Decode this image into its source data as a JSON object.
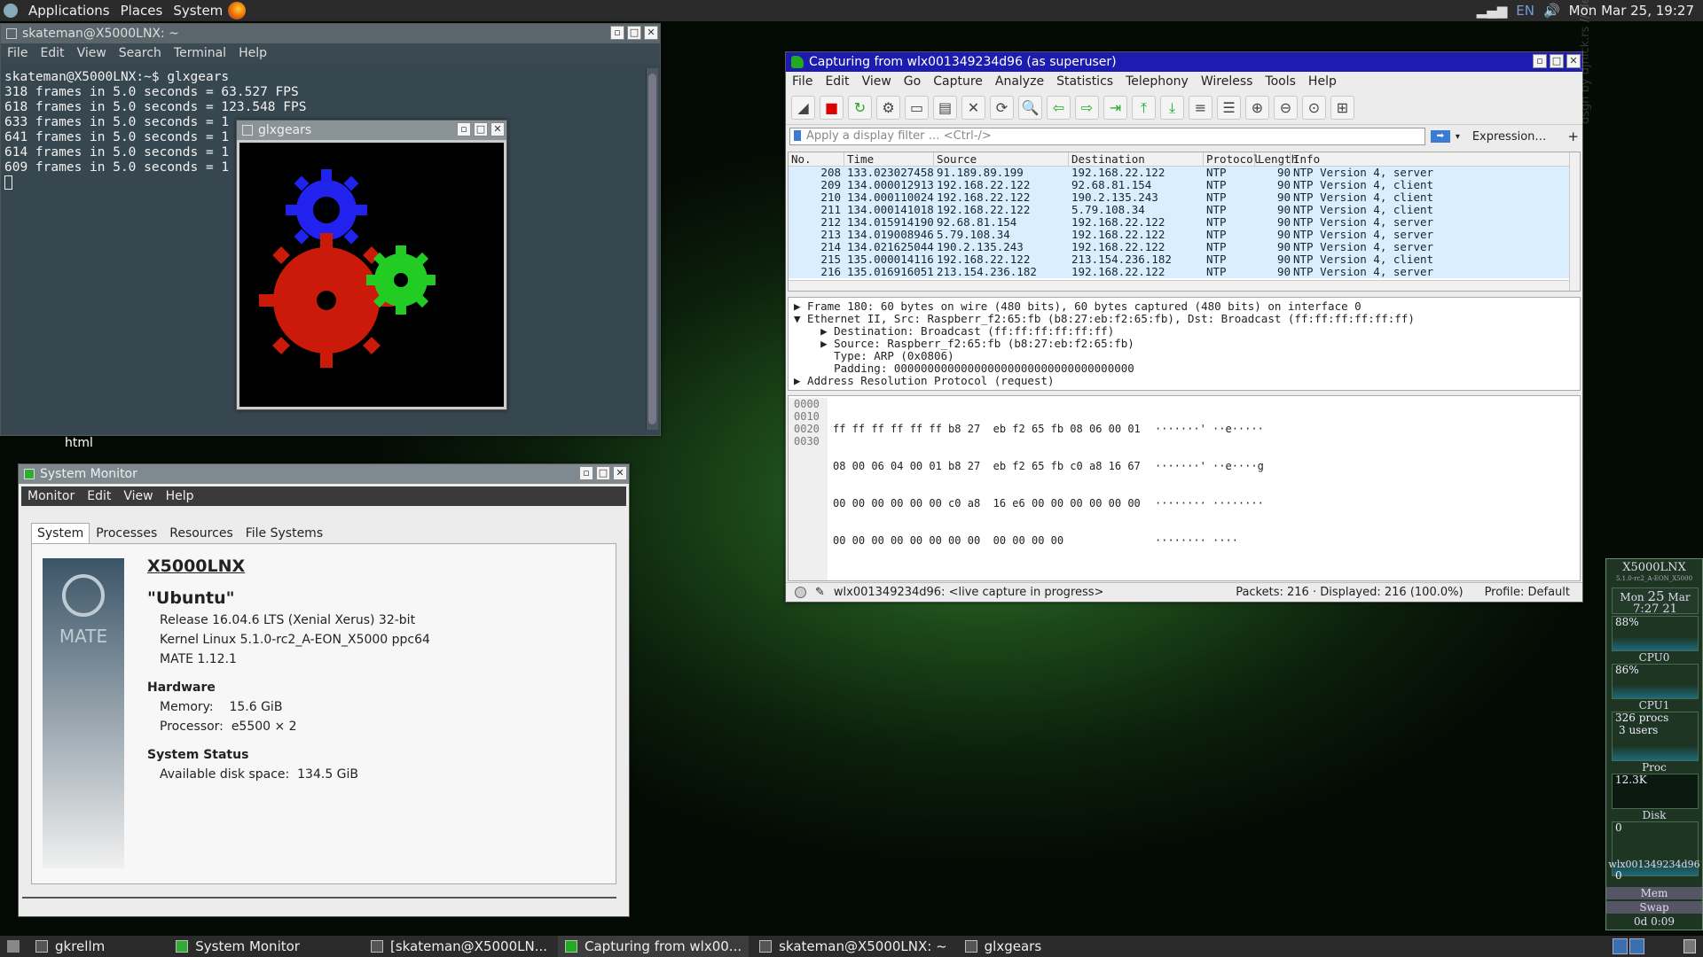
{
  "top_panel": {
    "menus": [
      "Applications",
      "Places",
      "System"
    ],
    "keyboard_layout": "EN",
    "clock": "Mon Mar 25, 19:27"
  },
  "terminal": {
    "title": "skateman@X5000LNX: ~",
    "menu": [
      "File",
      "Edit",
      "View",
      "Search",
      "Terminal",
      "Help"
    ],
    "lines": [
      "skateman@X5000LNX:~$ glxgears",
      "318 frames in 5.0 seconds = 63.527 FPS",
      "618 frames in 5.0 seconds = 123.548 FPS",
      "633 frames in 5.0 seconds = 1",
      "641 frames in 5.0 seconds = 1",
      "614 frames in 5.0 seconds = 1",
      "609 frames in 5.0 seconds = 1"
    ]
  },
  "glxgears": {
    "title": "glxgears"
  },
  "desktop": {
    "label": "html"
  },
  "system_monitor": {
    "title": "System Monitor",
    "menu": [
      "Monitor",
      "Edit",
      "View",
      "Help"
    ],
    "tabs": [
      "System",
      "Processes",
      "Resources",
      "File Systems"
    ],
    "logo_text": "MATE",
    "hostname": "X5000LNX",
    "distro": "\"Ubuntu\"",
    "release": "Release 16.04.6 LTS (Xenial Xerus) 32-bit",
    "kernel": "Kernel Linux 5.1.0-rc2_A-EON_X5000 ppc64",
    "mate": "MATE 1.12.1",
    "hardware_heading": "Hardware",
    "memory_label": "Memory:",
    "memory_value": "15.6 GiB",
    "processor_label": "Processor:",
    "processor_value": "e5500 × 2",
    "status_heading": "System Status",
    "disk_label": "Available disk space:",
    "disk_value": "134.5 GiB"
  },
  "wireshark": {
    "title": "Capturing from wlx001349234d96 (as superuser)",
    "menu": [
      "File",
      "Edit",
      "View",
      "Go",
      "Capture",
      "Analyze",
      "Statistics",
      "Telephony",
      "Wireless",
      "Tools",
      "Help"
    ],
    "filter_placeholder": "Apply a display filter … <Ctrl-/>",
    "expression_label": "Expression…",
    "plus_label": "+",
    "columns": [
      "No.",
      "Time",
      "Source",
      "Destination",
      "Protocol",
      "Length",
      "Info"
    ],
    "packets": [
      [
        "208",
        "133.023027458",
        "91.189.89.199",
        "192.168.22.122",
        "NTP",
        "90",
        "NTP Version 4, server"
      ],
      [
        "209",
        "134.000012913",
        "192.168.22.122",
        "92.68.81.154",
        "NTP",
        "90",
        "NTP Version 4, client"
      ],
      [
        "210",
        "134.000110024",
        "192.168.22.122",
        "190.2.135.243",
        "NTP",
        "90",
        "NTP Version 4, client"
      ],
      [
        "211",
        "134.000141018",
        "192.168.22.122",
        "5.79.108.34",
        "NTP",
        "90",
        "NTP Version 4, client"
      ],
      [
        "212",
        "134.015914190",
        "92.68.81.154",
        "192.168.22.122",
        "NTP",
        "90",
        "NTP Version 4, server"
      ],
      [
        "213",
        "134.019008946",
        "5.79.108.34",
        "192.168.22.122",
        "NTP",
        "90",
        "NTP Version 4, server"
      ],
      [
        "214",
        "134.021625044",
        "190.2.135.243",
        "192.168.22.122",
        "NTP",
        "90",
        "NTP Version 4, server"
      ],
      [
        "215",
        "135.000014116",
        "192.168.22.122",
        "213.154.236.182",
        "NTP",
        "90",
        "NTP Version 4, client"
      ],
      [
        "216",
        "135.016916051",
        "213.154.236.182",
        "192.168.22.122",
        "NTP",
        "90",
        "NTP Version 4, server"
      ]
    ],
    "details": [
      "▶ Frame 180: 60 bytes on wire (480 bits), 60 bytes captured (480 bits) on interface 0",
      "▼ Ethernet II, Src: Raspberr_f2:65:fb (b8:27:eb:f2:65:fb), Dst: Broadcast (ff:ff:ff:ff:ff:ff)",
      "    ▶ Destination: Broadcast (ff:ff:ff:ff:ff:ff)",
      "    ▶ Source: Raspberr_f2:65:fb (b8:27:eb:f2:65:fb)",
      "      Type: ARP (0x0806)",
      "      Padding: 000000000000000000000000000000000000",
      "▶ Address Resolution Protocol (request)"
    ],
    "hex_offsets": [
      "0000",
      "0010",
      "0020",
      "0030"
    ],
    "hex_bytes": [
      "ff ff ff ff ff ff b8 27  eb f2 65 fb 08 06 00 01",
      "08 00 06 04 00 01 b8 27  eb f2 65 fb c0 a8 16 67",
      "00 00 00 00 00 00 c0 a8  16 e6 00 00 00 00 00 00",
      "00 00 00 00 00 00 00 00  00 00 00 00"
    ],
    "hex_ascii": [
      "·······' ··e·····",
      "·······' ··e····g",
      "········ ········",
      "········ ····"
    ],
    "status_capture": "wlx001349234d96: <live capture in progress>",
    "status_packets": "Packets: 216 · Displayed: 216 (100.0%)",
    "status_profile": "Profile: Default"
  },
  "gkrellm": {
    "host": "X5000LNX",
    "kernel": "5.1.0-rc2_A-EON_X5000",
    "date_day": "Mon",
    "date_num": "25",
    "date_month": "Mar",
    "time": "7:27 21",
    "cpu0_pct": "88%",
    "cpu0_label": "CPU0",
    "cpu1_pct": "86%",
    "cpu1_label": "CPU1",
    "procs": "326 procs",
    "users": "3 users",
    "proc_label": "Proc",
    "disk_val": "12.3K",
    "disk_label": "Disk",
    "net_val": "0",
    "net_iface": "wlx001349234d96",
    "net_val2": "0",
    "mem_label": "Mem",
    "swap_label": "Swap",
    "uptime": "0d 0:09"
  },
  "taskbar": {
    "tasks": [
      "gkrellm",
      "System Monitor",
      "[skateman@X5000LN...",
      "Capturing from wlx00...",
      "skateman@X5000LNX: ~",
      "glxgears"
    ]
  },
  "wallpaper_watermark": "dsgn by djnick.rs // deetronic 2"
}
